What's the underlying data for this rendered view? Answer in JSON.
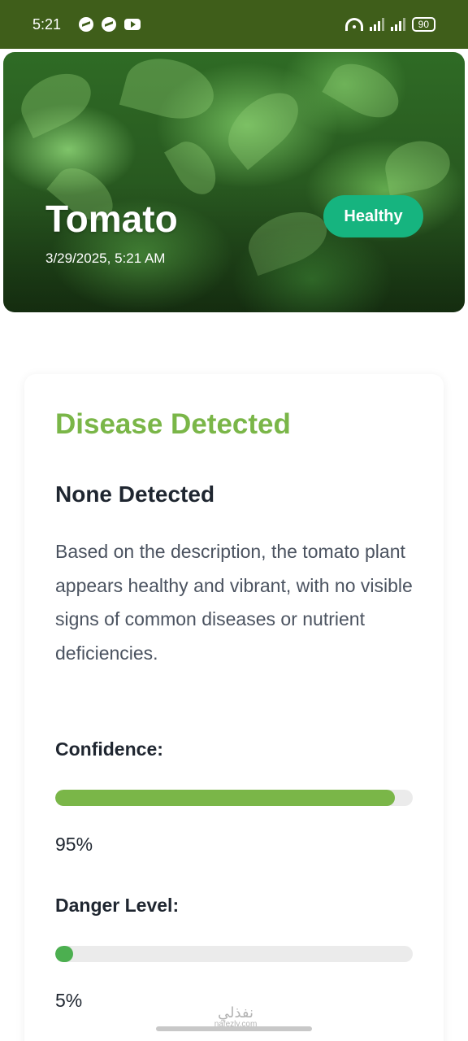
{
  "status_bar": {
    "time": "5:21",
    "battery": "90",
    "icons": [
      "messenger-icon",
      "messenger-icon",
      "youtube-icon",
      "wifi-icon",
      "signal-icon",
      "signal-icon",
      "battery-icon"
    ]
  },
  "hero": {
    "plant_name": "Tomato",
    "date": "3/29/2025, 5:21 AM",
    "status_badge": "Healthy",
    "badge_color": "#16b47f"
  },
  "result": {
    "heading": "Disease Detected",
    "heading_color": "#7ab648",
    "disease_name": "None Detected",
    "description": "Based on the description, the tomato plant appears healthy and vibrant, with no visible signs of common diseases or nutrient deficiencies.",
    "confidence": {
      "label": "Confidence:",
      "value": 0.95,
      "value_text": "95%",
      "color": "#7ab648"
    },
    "danger": {
      "label": "Danger Level:",
      "value": 0.05,
      "value_text": "5%",
      "color": "#4caf50"
    }
  },
  "watermark": {
    "arabic": "نفذلي",
    "latin": "nafezly.com"
  }
}
